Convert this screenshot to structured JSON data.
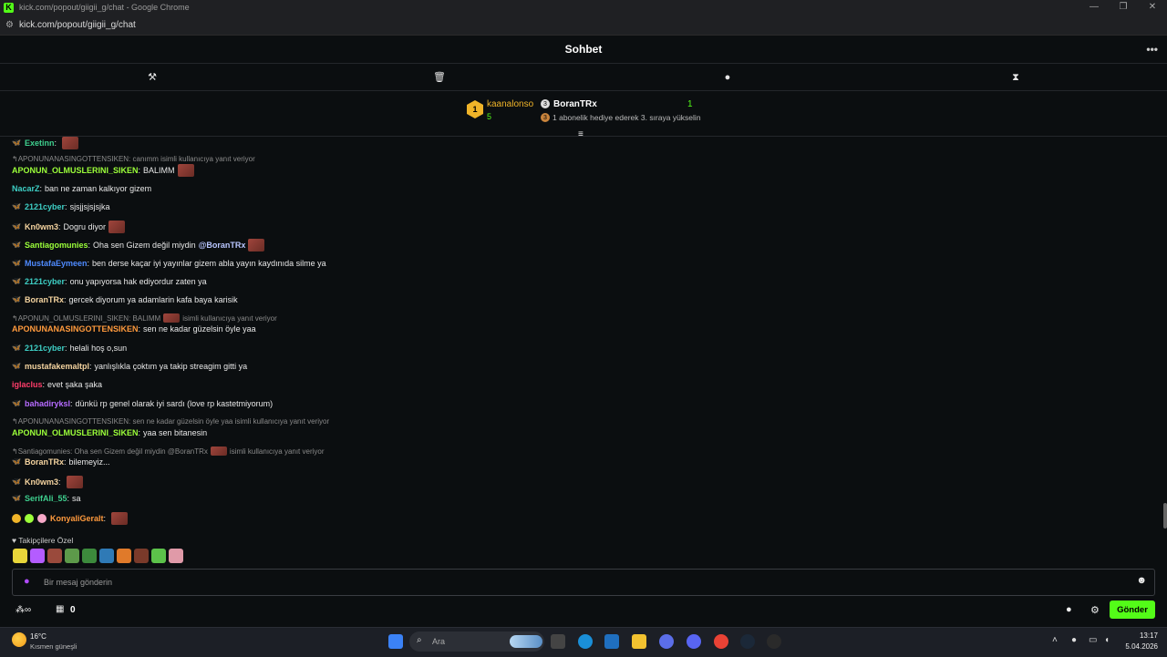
{
  "browser": {
    "title": "kick.com/popout/giigii_g/chat - Google Chrome",
    "url": "kick.com/popout/giigii_g/chat",
    "logo_letter": "K",
    "window_controls": [
      "—",
      "❐",
      "✕"
    ]
  },
  "chat_header": {
    "title": "Sohbet",
    "more": "•••"
  },
  "mod_bar": [
    "hammer-icon",
    "trash-icon",
    "chat-bubble-icon",
    "hourglass-icon"
  ],
  "pinned": {
    "gifter_rank": "1",
    "gifter_name": "kaanalonso",
    "gifter_count": "5",
    "top_name": "BoranTRx",
    "top_count": "1",
    "sub_text": "1 abonelik hediye ederek 3. sıraya yükselin"
  },
  "messages": [
    {
      "type": "msg",
      "badge": true,
      "user": "Exetinn",
      "color": "#3ecf8e",
      "text": "",
      "emote": true
    },
    {
      "type": "reply",
      "text": "APONUNANASINGOTTENSIKEN: canımm isimli kullanıcıya yanıt veriyor"
    },
    {
      "type": "msg",
      "badge": false,
      "user": "APONUN_OLMUSLERINI_SIKEN",
      "color": "#9cff3a",
      "text": "BALIMM",
      "emote": true
    },
    {
      "type": "msg",
      "badge": false,
      "user": "NacarZ",
      "color": "#3ecfc5",
      "text": "ban ne zaman kalkıyor gizem",
      "emote": false
    },
    {
      "type": "msg",
      "badge": true,
      "user": "2121cyber",
      "color": "#3ecfc5",
      "text": "sjsjjsjsjsjka",
      "emote": false
    },
    {
      "type": "msg",
      "badge": true,
      "user": "Kn0wm3",
      "color": "#f5d4a0",
      "text": "Dogru diyor",
      "emote": true
    },
    {
      "type": "msg",
      "badge": true,
      "user": "Santiagomunies",
      "color": "#9cff3a",
      "text": "Oha sen Gizem değil miydin",
      "mention": "@BoranTRx",
      "emote": true
    },
    {
      "type": "msg",
      "badge": true,
      "user": "MustafaEymeen",
      "color": "#4f8bff",
      "text": "ben derse kaçar iyi yayınlar gizem abla yayın kaydınıda silme ya",
      "emote": false
    },
    {
      "type": "msg",
      "badge": true,
      "user": "2121cyber",
      "color": "#3ecfc5",
      "text": "onu yapıyorsa hak ediyordur zaten ya",
      "emote": false
    },
    {
      "type": "msg",
      "badge": true,
      "user": "BoranTRx",
      "color": "#f5d4a0",
      "text": "gercek diyorum ya adamlarin kafa baya karisik",
      "emote": false
    },
    {
      "type": "reply",
      "text": "APONUN_OLMUSLERINI_SIKEN: BALIMM",
      "emote": true,
      "text2": "isimli kullanıcıya yanıt veriyor"
    },
    {
      "type": "msg",
      "badge": false,
      "user": "APONUNANASINGOTTENSIKEN",
      "color": "#ff9a3d",
      "text": "sen ne kadar güzelsin öyle yaa",
      "emote": false
    },
    {
      "type": "msg",
      "badge": true,
      "user": "2121cyber",
      "color": "#3ecfc5",
      "text": "helali hoş o,sun",
      "emote": false
    },
    {
      "type": "msg",
      "badge": true,
      "user": "mustafakemaltpl",
      "color": "#f5d4a0",
      "text": "yanlışlıkla çoktım ya takip streagim gitti ya",
      "emote": false
    },
    {
      "type": "msg",
      "badge": false,
      "user": "iglaclus",
      "color": "#ff3d6a",
      "text": "evet şaka şaka",
      "emote": false
    },
    {
      "type": "msg",
      "badge": true,
      "user": "bahadiryksl",
      "color": "#b66bff",
      "text": "dünkü rp genel olarak iyi sardı (love rp kastetmiyorum)",
      "emote": false
    },
    {
      "type": "reply",
      "text": "APONUNANASINGOTTENSIKEN: sen ne kadar güzelsin öyle yaa isimli kullanıcıya yanıt veriyor"
    },
    {
      "type": "msg",
      "badge": false,
      "user": "APONUN_OLMUSLERINI_SIKEN",
      "color": "#9cff3a",
      "text": "yaa sen bitanesin",
      "emote": false
    },
    {
      "type": "reply",
      "text": "Santiagomunies: Oha sen Gizem değil miydin @BoranTRx",
      "emote": true,
      "text2": "isimli kullanıcıya yanıt veriyor"
    },
    {
      "type": "msg",
      "badge": true,
      "user": "BoranTRx",
      "color": "#f5d4a0",
      "text": "bilemeyiz...",
      "emote": false
    },
    {
      "type": "msg",
      "badge": true,
      "user": "Kn0wm3",
      "color": "#f5d4a0",
      "text": "",
      "emote": true
    },
    {
      "type": "msg",
      "badge": true,
      "user": "SerifAli_55",
      "color": "#3ecf8e",
      "text": "sa",
      "emote": false
    },
    {
      "type": "msg",
      "badge": true,
      "triple": true,
      "user": "KonyaliGeralt",
      "color": "#ff9a3d",
      "text": "",
      "emote": true
    }
  ],
  "followers_label": "Takipçilere Özel",
  "emote_colors": [
    "#e8d63a",
    "#b45cff",
    "#9a4a3c",
    "#5d9a4a",
    "#3c8a3c",
    "#2f7ab6",
    "#e07a2a",
    "#7a3a2a",
    "#5cc24a",
    "#e09aa8"
  ],
  "input": {
    "placeholder": "Bir mesaj gönderin"
  },
  "bottom": {
    "count": "0",
    "send": "Gönder"
  },
  "taskbar": {
    "temp": "16°C",
    "weather": "Kısmen güneşli",
    "search": "Ara",
    "time": "13:17",
    "date": "5.04.2026"
  },
  "colors": {
    "accent": "#53fc18",
    "bg": "#0b0e10",
    "gold": "#f0b429"
  }
}
